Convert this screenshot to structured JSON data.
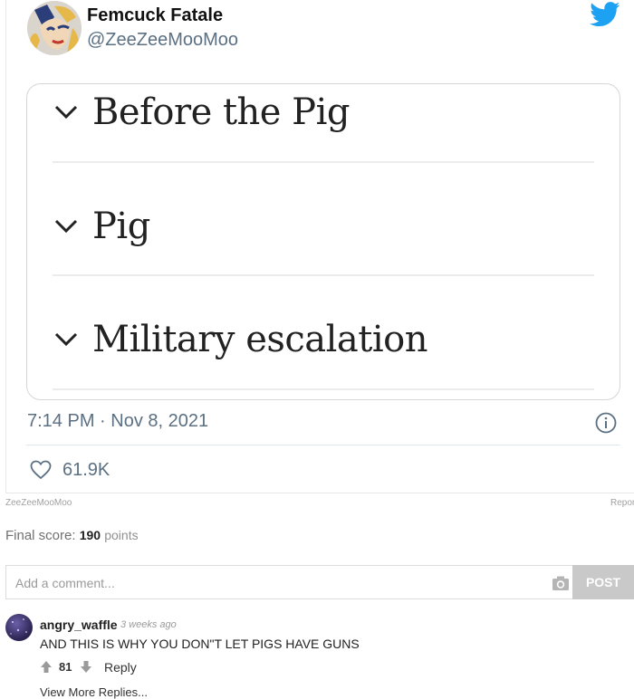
{
  "tweet": {
    "display_name": "Femcuck Fatale",
    "handle": "@ZeeZeeMooMoo",
    "items": [
      {
        "label": "Before the Pig"
      },
      {
        "label": "Pig"
      },
      {
        "label": "Military escalation"
      }
    ],
    "timestamp": "7:14 PM · Nov 8, 2021",
    "likes": "61.9K",
    "icons": {
      "brand": "twitter-bird-icon",
      "chevron": "chevron-down-icon",
      "info": "info-icon",
      "like": "heart-icon"
    },
    "colors": {
      "brand": "#1da1f2",
      "meta": "#5b7083"
    }
  },
  "credit": "ZeeZeeMooMoo",
  "report_label": "Report",
  "score": {
    "label": "Final score:",
    "value": "190",
    "unit": "points"
  },
  "comment_input": {
    "placeholder": "Add a comment...",
    "post_label": "POST"
  },
  "comment": {
    "username": "angry_waffle",
    "time": "3 weeks ago",
    "text": "AND THIS IS WHY YOU DON\"T LET PIGS HAVE GUNS",
    "votes": "81",
    "reply_label": "Reply",
    "view_more": "View More Replies..."
  }
}
